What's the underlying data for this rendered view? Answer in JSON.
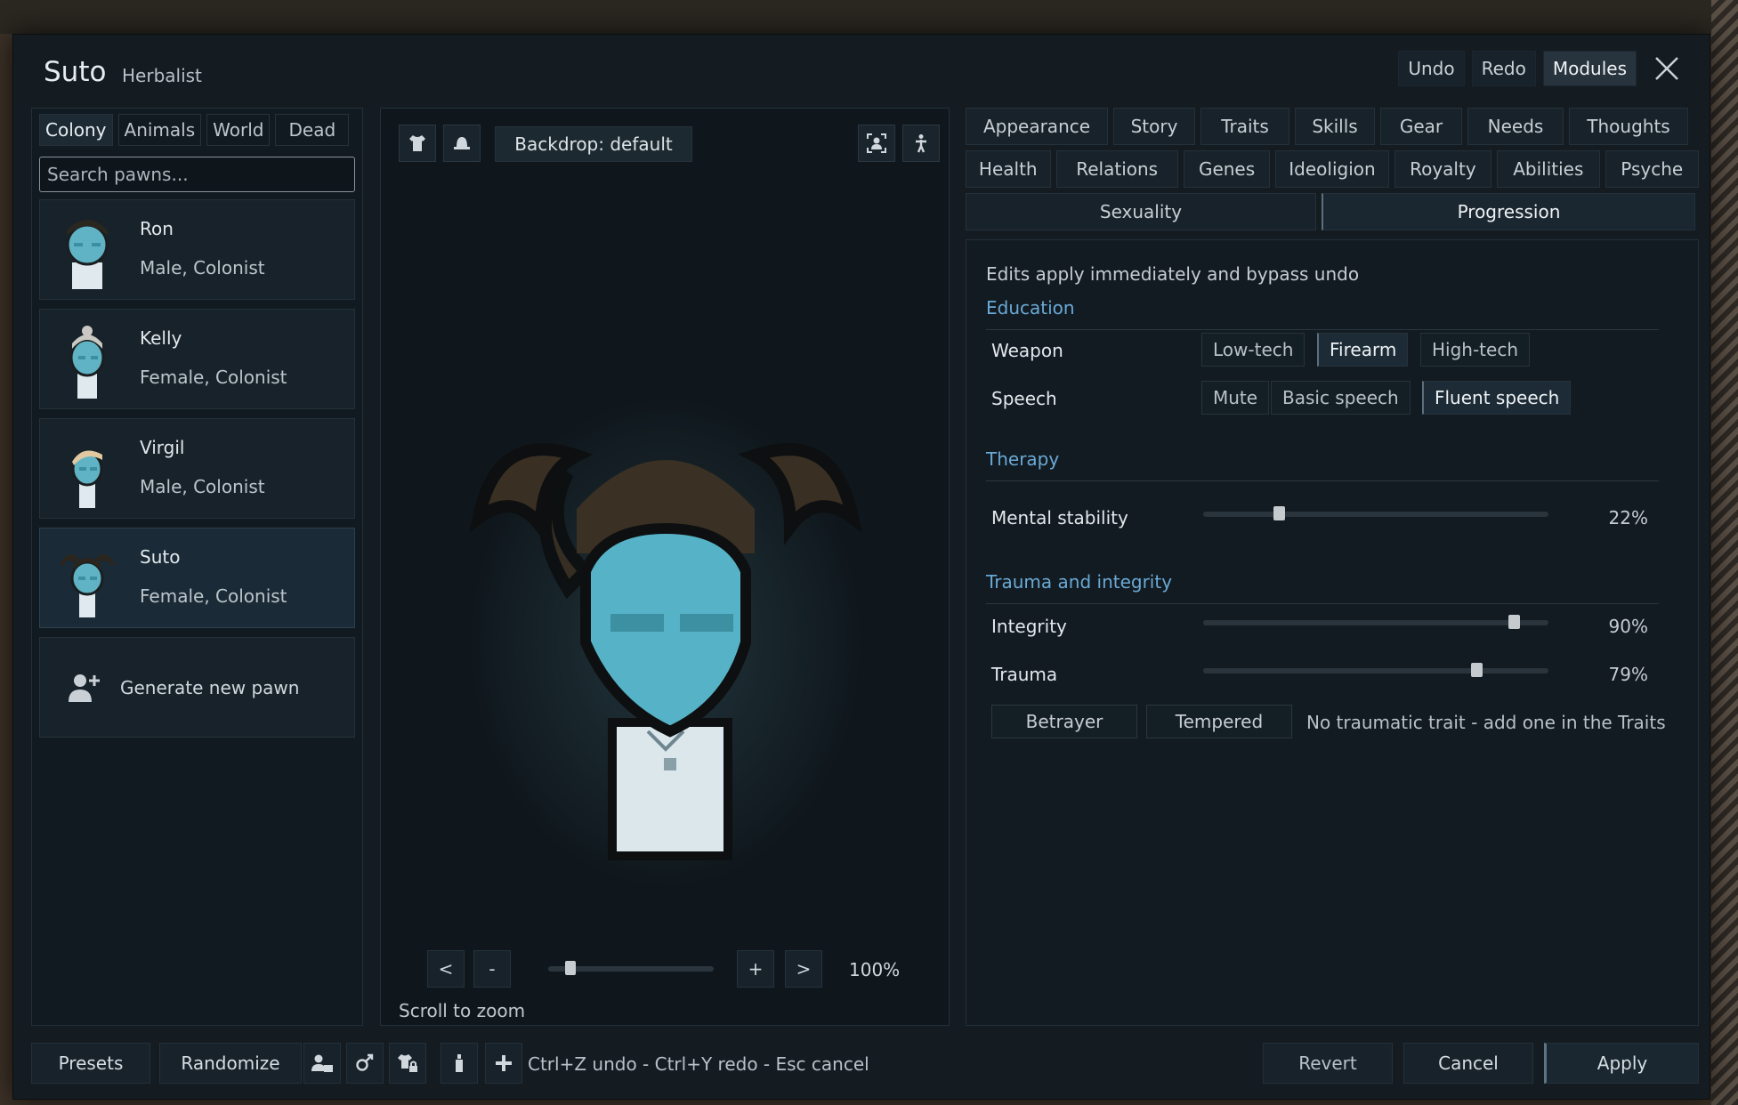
{
  "window": {
    "title": "Suto",
    "subtitle": "Herbalist",
    "actions": [
      "Undo",
      "Redo",
      "Modules"
    ],
    "close_icon": "close-icon"
  },
  "left": {
    "tabs": [
      "Colony",
      "Animals",
      "World",
      "Dead"
    ],
    "active_tab": "Colony",
    "search_placeholder": "Search pawns...",
    "pawns": [
      {
        "name": "Ron",
        "desc": "Male, Colonist"
      },
      {
        "name": "Kelly",
        "desc": "Female, Colonist"
      },
      {
        "name": "Virgil",
        "desc": "Male, Colonist"
      },
      {
        "name": "Suto",
        "desc": "Female, Colonist"
      }
    ],
    "selected_pawn": "Suto",
    "generate_label": "Generate new pawn"
  },
  "preview": {
    "backdrop_label": "Backdrop: default",
    "zoom_prev": "<",
    "zoom_out": "-",
    "zoom_in": "+",
    "zoom_next": ">",
    "zoom_pct": "100%",
    "zoom_level": 0.1,
    "scroll_hint": "Scroll to zoom",
    "icons": [
      "shirt-icon",
      "hat-icon",
      "portrait-frame-icon",
      "body-pose-icon"
    ]
  },
  "tabs": {
    "row1": [
      "Appearance",
      "Story",
      "Traits",
      "Skills",
      "Gear",
      "Needs",
      "Thoughts"
    ],
    "row2": [
      "Health",
      "Relations",
      "Genes",
      "Ideoligion",
      "Royalty",
      "Abilities",
      "Psyche"
    ],
    "row3": [
      "Sexuality",
      "Progression"
    ],
    "active": "Progression"
  },
  "panel": {
    "note": "Edits apply immediately and bypass undo",
    "education": {
      "title": "Education",
      "weapon_label": "Weapon",
      "weapon_options": [
        "Low-tech",
        "Firearm",
        "High-tech"
      ],
      "weapon_selected": "Firearm",
      "speech_label": "Speech",
      "speech_options": [
        "Mute",
        "Basic speech",
        "Fluent speech"
      ],
      "speech_selected": "Fluent speech"
    },
    "therapy": {
      "title": "Therapy",
      "mental_label": "Mental stability",
      "mental_value": 0.22,
      "mental_pct": "22%"
    },
    "trauma": {
      "title": "Trauma and integrity",
      "integrity_label": "Integrity",
      "integrity_value": 0.9,
      "integrity_pct": "90%",
      "trauma_label": "Trauma",
      "trauma_value": 0.79,
      "trauma_pct": "79%",
      "buttons": [
        "Betrayer",
        "Tempered"
      ],
      "note": "No traumatic trait - add one in the Traits"
    }
  },
  "bottom": {
    "presets": "Presets",
    "randomize": "Randomize",
    "hint": "Ctrl+Z undo  -  Ctrl+Y redo  -  Esc cancel",
    "revert": "Revert",
    "cancel": "Cancel",
    "apply": "Apply",
    "icons": [
      "person-card-icon",
      "gender-icon",
      "apparel-lock-icon",
      "bottle-icon",
      "plus-icon"
    ]
  }
}
